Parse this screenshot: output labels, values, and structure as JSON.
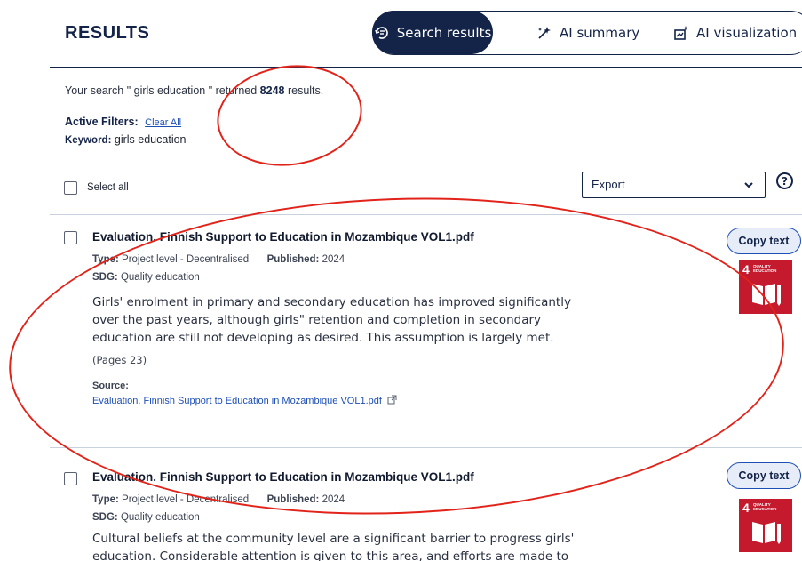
{
  "header": {
    "title": "RESULTS",
    "tabs": [
      {
        "label": "Search results",
        "icon": "search-results-icon",
        "active": true
      },
      {
        "label": "AI summary",
        "icon": "ai-sparkle-icon",
        "active": false
      },
      {
        "label": "AI visualization",
        "icon": "ai-chart-icon",
        "active": false
      }
    ]
  },
  "summary": {
    "prefix": "Your search \" girls education \" returned",
    "count": "8248",
    "suffix": "results."
  },
  "filters": {
    "label": "Active Filters:",
    "clear_label": "Clear All",
    "keyword_label": "Keyword:",
    "keyword_value": "girls education"
  },
  "toolbar": {
    "select_all_label": "Select all",
    "export_label": "Export",
    "help_label": "?"
  },
  "results": [
    {
      "title": "Evaluation. Finnish Support to Education in Mozambique VOL1.pdf",
      "type_label": "Type:",
      "type_value": "Project level - Decentralised",
      "published_label": "Published:",
      "published_value": "2024",
      "sdg_label": "SDG:",
      "sdg_value": "Quality education",
      "text": "Girls' enrolment in primary and secondary education has improved significantly over the past years, although girls\" retention and completion in secondary education are still not developing as desired. This assumption is largely met.",
      "pages": "(Pages 23)",
      "source_label": "Source:",
      "source_link": "Evaluation. Finnish Support to Education in Mozambique VOL1.pdf",
      "copy_label": "Copy text",
      "sdg_badge": {
        "number": "4",
        "text": "QUALITY EDUCATION",
        "color": "#c5192d"
      }
    },
    {
      "title": "Evaluation. Finnish Support to Education in Mozambique VOL1.pdf",
      "type_label": "Type:",
      "type_value": "Project level - Decentralised",
      "published_label": "Published:",
      "published_value": "2024",
      "sdg_label": "SDG:",
      "sdg_value": "Quality education",
      "text": "Cultural beliefs at the community level are a significant barrier to progress girls' education. Considerable attention is given to this area, and efforts are made to involve",
      "copy_label": "Copy text",
      "sdg_badge": {
        "number": "4",
        "text": "QUALITY EDUCATION",
        "color": "#c5192d"
      }
    }
  ],
  "colors": {
    "primary": "#142448",
    "link": "#1d4fb5",
    "annotation": "#e2231a",
    "sdg4": "#c5192d"
  }
}
